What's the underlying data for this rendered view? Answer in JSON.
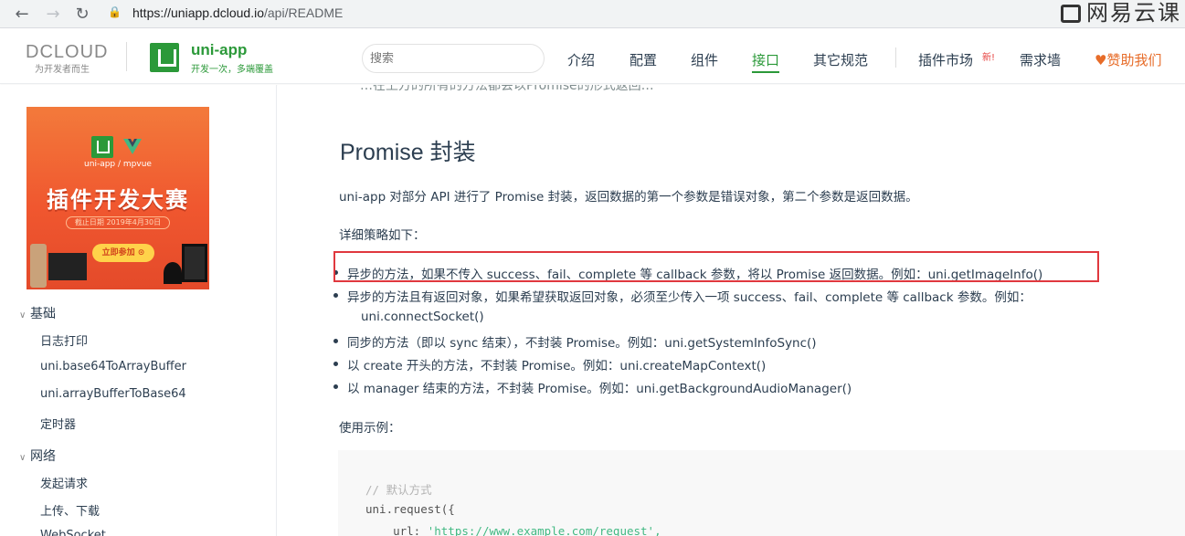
{
  "browser": {
    "back_icon": "arrow-left-icon",
    "forward_icon": "arrow-right-icon",
    "reload_icon": "reload-icon",
    "url_host": "https://uniapp.dcloud.io",
    "url_path": "/api/README",
    "watermark": "网易云课"
  },
  "header": {
    "dcloud_logo": "DCLOUD",
    "dcloud_slogan": "为开发者而生",
    "uni_name": "uni-app",
    "uni_slogan": "开发一次，多端覆盖",
    "search_placeholder": "搜索",
    "nav": [
      "介绍",
      "配置",
      "组件",
      "接口",
      "其它规范",
      "插件市场",
      "需求墙"
    ],
    "active_nav": "接口",
    "new_badge": "新!",
    "sponsor": "赞助我们",
    "accent": "#2b9939",
    "sponsor_color": "#e76c29"
  },
  "sidebar": {
    "banner": {
      "sub": "uni-app / mpvue",
      "title": "插件开发大赛",
      "date": "截止日期 2019年4月30日",
      "button": "立即参加 ⊙"
    },
    "groups": [
      {
        "label": "基础",
        "items": [
          "日志打印",
          "uni.base64ToArrayBuffer",
          "uni.arrayBufferToBase64",
          "定时器"
        ]
      },
      {
        "label": "网络",
        "items": [
          "发起请求",
          "上传、下载",
          "WebSocket"
        ]
      }
    ]
  },
  "main": {
    "clipped_line": "…在上方的所有的方法都会以Promise的形式返回…",
    "heading": "Promise 封装",
    "intro": "uni-app 对部分 API 进行了 Promise 封装，返回数据的第一个参数是错误对象，第二个参数是返回数据。",
    "strategy_label": "详细策略如下：",
    "bullets": [
      "异步的方法，如果不传入 success、fail、complete 等 callback 参数，将以 Promise 返回数据。例如：uni.getImageInfo()",
      "异步的方法且有返回对象，如果希望获取返回对象，必须至少传入一项 success、fail、complete 等 callback 参数。例如：",
      "uni.connectSocket()",
      "同步的方法（即以 sync 结束），不封装 Promise。例如：uni.getSystemInfoSync()",
      "以 create 开头的方法，不封装 Promise。例如：uni.createMapContext()",
      "以 manager 结束的方法，不封装 Promise。例如：uni.getBackgroundAudioManager()"
    ],
    "usage_label": "使用示例：",
    "code": {
      "comment": "// 默认方式",
      "line2": "uni.request({",
      "line3_key": "    url: ",
      "line3_str": "'https://www.example.com/request',"
    },
    "highlight_color": "#e0383e"
  }
}
